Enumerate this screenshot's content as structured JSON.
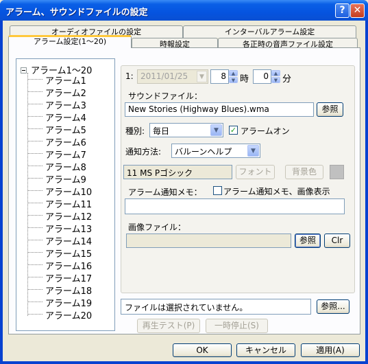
{
  "window": {
    "title": "アラーム、サウンドファイルの設定",
    "help_label": "?",
    "close_label": "✕"
  },
  "tabs": {
    "row1": [
      "オーディオファイルの設定",
      "インターバルアラーム設定"
    ],
    "row2": [
      "アラーム設定(1〜20)",
      "時報設定",
      "各正時の音声ファイル設定"
    ]
  },
  "tree": {
    "root": "アラーム1〜20",
    "items": [
      "アラーム1",
      "アラーム2",
      "アラーム3",
      "アラーム4",
      "アラーム5",
      "アラーム6",
      "アラーム7",
      "アラーム8",
      "アラーム9",
      "アラーム10",
      "アラーム11",
      "アラーム12",
      "アラーム13",
      "アラーム14",
      "アラーム15",
      "アラーム16",
      "アラーム17",
      "アラーム18",
      "アラーム19",
      "アラーム20"
    ]
  },
  "alarm": {
    "number_label": "1:",
    "date": "2011/01/25",
    "hour": "8",
    "hour_label": "時",
    "minute": "0",
    "minute_label": "分",
    "sound_file_label": "サウンドファイル：",
    "sound_file": "New Stories (Highway Blues).wma",
    "browse_label": "参照",
    "type_label": "種別:",
    "type_value": "毎日",
    "alarm_on_label": "アラームオン",
    "notify_label": "通知方法:",
    "notify_value": "バルーンヘルプ",
    "font_display": "11 MS Pゴシック",
    "font_button": "フォント",
    "bgcolor_button": "背景色",
    "memo_label": "アラーム通知メモ：",
    "memo_image_label": "アラーム通知メモ、画像表示",
    "memo_value": "",
    "image_file_label": "画像ファイル：",
    "image_file_value": "",
    "image_browse_label": "参照",
    "clear_label": "Clr"
  },
  "audio": {
    "status": "ファイルは選択されていません。",
    "browse_label": "参照...",
    "play_test_label": "再生テスト(P)",
    "pause_label": "一時停止(S)"
  },
  "footer": {
    "ok_label": "OK",
    "cancel_label": "キャンセル",
    "apply_label": "適用(A)"
  }
}
